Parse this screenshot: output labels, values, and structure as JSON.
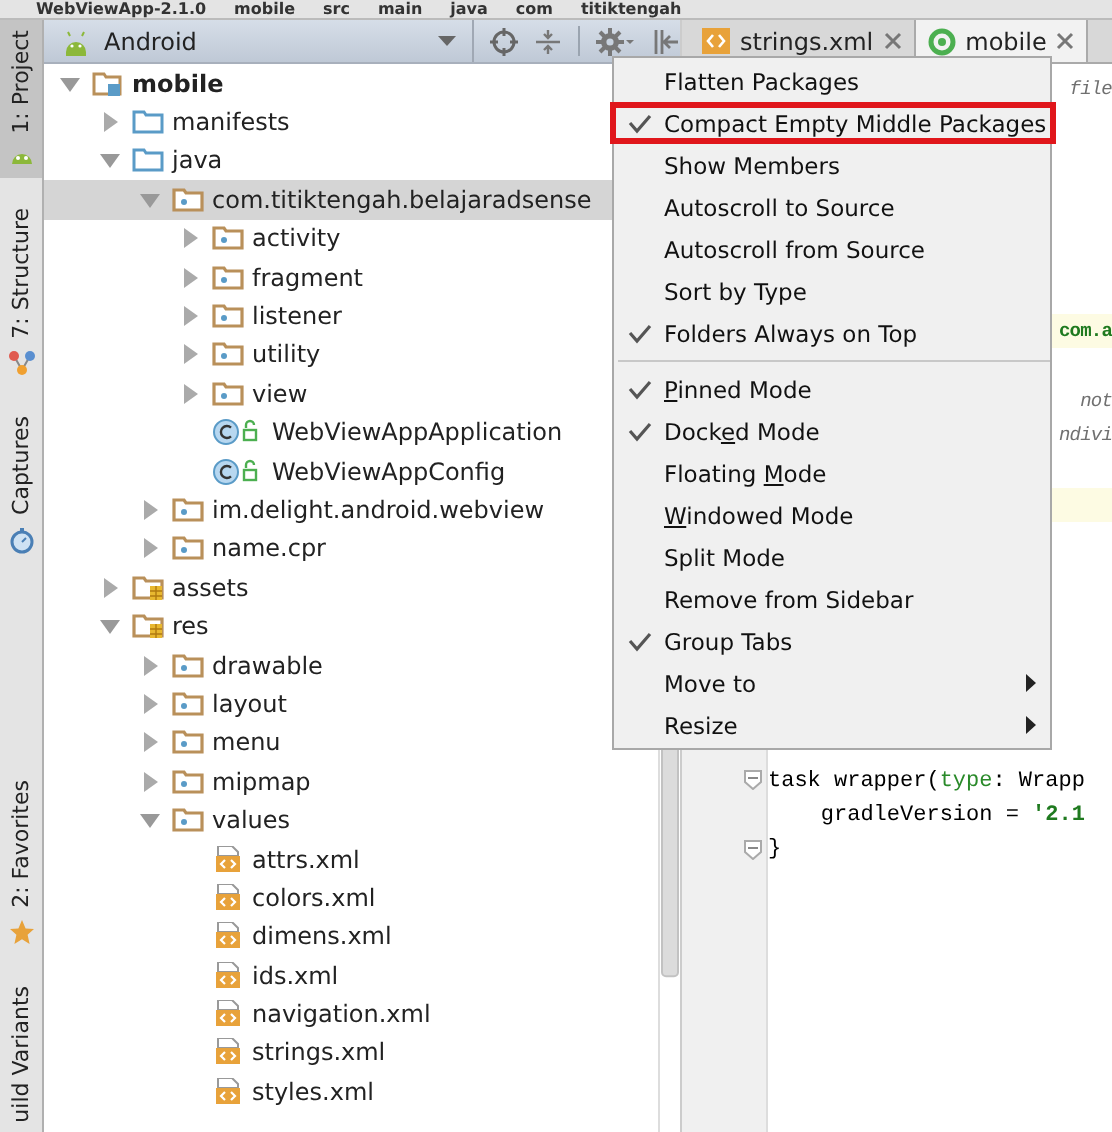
{
  "breadcrumbs": [
    "WebViewApp-2.1.0",
    "mobile",
    "src",
    "main",
    "java",
    "com",
    "titiktengah"
  ],
  "tool_strip": {
    "top": [
      {
        "label": "1: Project",
        "kind": "android",
        "selected": true
      },
      {
        "label": "7: Structure",
        "kind": "structure",
        "selected": false
      },
      {
        "label": "Captures",
        "kind": "captures",
        "selected": false
      }
    ],
    "bottom": [
      {
        "label": "2: Favorites",
        "kind": "favorites",
        "selected": false
      },
      {
        "label": "uild Variants",
        "kind": "plain",
        "selected": false
      }
    ]
  },
  "project_panel": {
    "view": "Android",
    "tree": [
      {
        "label": "mobile",
        "kind": "module",
        "bold": true,
        "expanded": true,
        "selected": false,
        "children": [
          {
            "label": "manifests",
            "kind": "folder",
            "expanded": false,
            "selected": false
          },
          {
            "label": "java",
            "kind": "folder",
            "expanded": true,
            "selected": false,
            "children": [
              {
                "label": "com.titiktengah.belajaradsense",
                "kind": "package",
                "expanded": true,
                "selected": true,
                "children": [
                  {
                    "label": "activity",
                    "kind": "package",
                    "expanded": false,
                    "selected": false
                  },
                  {
                    "label": "fragment",
                    "kind": "package",
                    "expanded": false,
                    "selected": false
                  },
                  {
                    "label": "listener",
                    "kind": "package",
                    "expanded": false,
                    "selected": false
                  },
                  {
                    "label": "utility",
                    "kind": "package",
                    "expanded": false,
                    "selected": false
                  },
                  {
                    "label": "view",
                    "kind": "package",
                    "expanded": false,
                    "selected": false
                  },
                  {
                    "label": "WebViewAppApplication",
                    "kind": "class",
                    "selected": false
                  },
                  {
                    "label": "WebViewAppConfig",
                    "kind": "class",
                    "selected": false
                  }
                ]
              },
              {
                "label": "im.delight.android.webview",
                "kind": "package",
                "expanded": false,
                "selected": false
              },
              {
                "label": "name.cpr",
                "kind": "package",
                "expanded": false,
                "selected": false
              }
            ]
          },
          {
            "label": "assets",
            "kind": "resfolder",
            "expanded": false,
            "selected": false
          },
          {
            "label": "res",
            "kind": "resfolder",
            "expanded": true,
            "selected": false,
            "children": [
              {
                "label": "drawable",
                "kind": "package",
                "expanded": false,
                "selected": false
              },
              {
                "label": "layout",
                "kind": "package",
                "expanded": false,
                "selected": false
              },
              {
                "label": "menu",
                "kind": "package",
                "expanded": false,
                "selected": false
              },
              {
                "label": "mipmap",
                "kind": "package",
                "expanded": false,
                "selected": false
              },
              {
                "label": "values",
                "kind": "package",
                "expanded": true,
                "selected": false,
                "children": [
                  {
                    "label": "attrs.xml",
                    "kind": "xml",
                    "selected": false
                  },
                  {
                    "label": "colors.xml",
                    "kind": "xml",
                    "selected": false
                  },
                  {
                    "label": "dimens.xml",
                    "kind": "xml",
                    "selected": false
                  },
                  {
                    "label": "ids.xml",
                    "kind": "xml",
                    "selected": false
                  },
                  {
                    "label": "navigation.xml",
                    "kind": "xml",
                    "selected": false
                  },
                  {
                    "label": "strings.xml",
                    "kind": "xml",
                    "selected": false
                  },
                  {
                    "label": "styles.xml",
                    "kind": "xml",
                    "selected": false
                  }
                ]
              }
            ]
          }
        ]
      }
    ]
  },
  "editor_tabs": [
    {
      "label": "strings.xml",
      "kind": "xml",
      "selected": false
    },
    {
      "label": "mobile",
      "kind": "gradle",
      "selected": true
    }
  ],
  "code_lines": [
    {
      "kind": "partial",
      "highlight": false,
      "segments": [
        {
          "text": "file",
          "kind": "comment"
        }
      ]
    },
    {
      "kind": "partial",
      "highlight": true,
      "segments": [
        {
          "text": "com.a",
          "kind": "string"
        }
      ]
    },
    {
      "kind": "partial",
      "highlight": false,
      "segments": [
        {
          "text": "not",
          "kind": "comment"
        }
      ]
    },
    {
      "kind": "partial",
      "highlight": false,
      "segments": [
        {
          "text": "ndivi",
          "kind": "comment"
        }
      ]
    },
    {
      "kind": "partial",
      "highlight": true
    },
    {
      "kind": "full",
      "highlight": false,
      "fold": true,
      "segments": [
        {
          "text": "task wrapper(",
          "kind": "plain"
        },
        {
          "text": "type",
          "kind": "keyword"
        },
        {
          "text": ": Wrapp",
          "kind": "plain"
        }
      ]
    },
    {
      "kind": "full",
      "highlight": false,
      "fold": false,
      "segments": [
        {
          "text": "    gradleVersion = ",
          "kind": "plain"
        },
        {
          "text": "'2.1",
          "kind": "string"
        }
      ]
    },
    {
      "kind": "full",
      "highlight": false,
      "fold": true,
      "segments": [
        {
          "text": "}",
          "kind": "plain"
        }
      ]
    }
  ],
  "menu": {
    "items": [
      {
        "kind": "item",
        "label": "Flatten Packages",
        "checked": false,
        "outlined": false,
        "submenu": false
      },
      {
        "kind": "item",
        "label": "Compact Empty Middle Packages",
        "checked": true,
        "outlined": true,
        "submenu": false
      },
      {
        "kind": "item",
        "label": "Show Members",
        "checked": false,
        "outlined": false,
        "submenu": false
      },
      {
        "kind": "item",
        "label": "Autoscroll to Source",
        "checked": false,
        "outlined": false,
        "submenu": false
      },
      {
        "kind": "item",
        "label": "Autoscroll from Source",
        "checked": false,
        "outlined": false,
        "submenu": false
      },
      {
        "kind": "item",
        "label": "Sort by Type",
        "checked": false,
        "outlined": false,
        "submenu": false
      },
      {
        "kind": "item",
        "label": "Folders Always on Top",
        "checked": true,
        "outlined": false,
        "submenu": false
      },
      {
        "kind": "separator"
      },
      {
        "kind": "mnemonic",
        "key": "P",
        "after": "inned Mode",
        "checked": true,
        "outlined": false,
        "submenu": false
      },
      {
        "kind": "mnemonic",
        "before": "Dock",
        "key": "e",
        "after": "d Mode",
        "checked": true,
        "outlined": false,
        "submenu": false
      },
      {
        "kind": "mnemonic",
        "before": "Floating ",
        "key": "M",
        "after": "ode",
        "checked": false,
        "outlined": false,
        "submenu": false
      },
      {
        "kind": "mnemonic",
        "key": "W",
        "after": "indowed Mode",
        "checked": false,
        "outlined": false,
        "submenu": false
      },
      {
        "kind": "item",
        "label": "Split Mode",
        "checked": false,
        "outlined": false,
        "submenu": false
      },
      {
        "kind": "item",
        "label": "Remove from Sidebar",
        "checked": false,
        "outlined": false,
        "submenu": false
      },
      {
        "kind": "item",
        "label": "Group Tabs",
        "checked": true,
        "outlined": false,
        "submenu": false
      },
      {
        "kind": "item",
        "label": "Move to",
        "checked": false,
        "outlined": false,
        "submenu": true
      },
      {
        "kind": "item",
        "label": "Resize",
        "checked": false,
        "outlined": false,
        "submenu": true
      }
    ]
  }
}
